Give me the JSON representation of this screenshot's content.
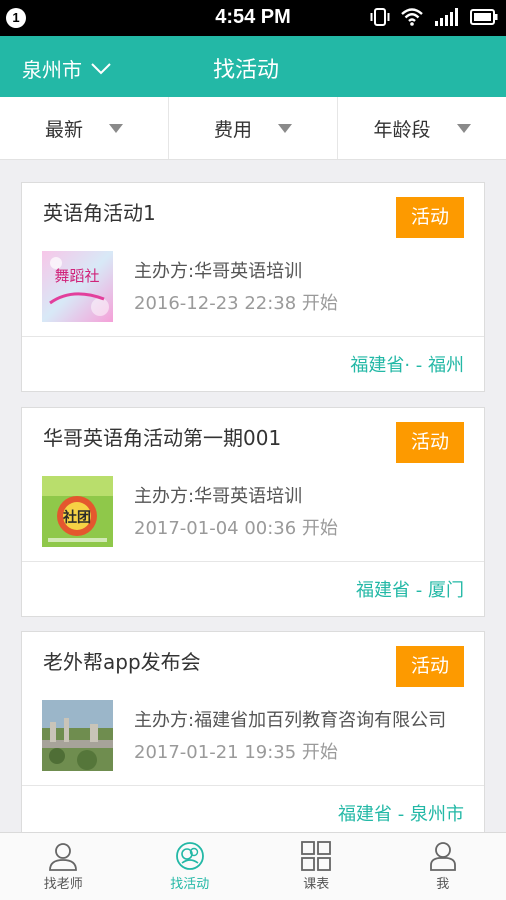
{
  "status_bar": {
    "notification_count": "1",
    "time": "4:54 PM"
  },
  "header": {
    "city": "泉州市",
    "title": "找活动"
  },
  "filters": [
    {
      "label": "最新"
    },
    {
      "label": "费用"
    },
    {
      "label": "年龄段"
    }
  ],
  "badge_label": "活动",
  "activities": [
    {
      "title": "英语角活动1",
      "organizer": "主办方:华哥英语培训",
      "datetime": "2016-12-23 22:38 开始",
      "location": "福建省· - 福州",
      "thumb_text": "舞蹈社"
    },
    {
      "title": "华哥英语角活动第一期001",
      "organizer": "主办方:华哥英语培训",
      "datetime": "2017-01-04 00:36 开始",
      "location": "福建省 - 厦门",
      "thumb_text": "社团"
    },
    {
      "title": "老外帮app发布会",
      "organizer": " 主办方:福建省加百列教育咨询有限公司",
      "datetime": "2017-01-21 19:35 开始",
      "location": "福建省 - 泉州市",
      "thumb_text": ""
    }
  ],
  "tabs": [
    {
      "label": "找老师",
      "icon": "teacher-icon"
    },
    {
      "label": "找活动",
      "icon": "activity-icon"
    },
    {
      "label": "课表",
      "icon": "schedule-icon"
    },
    {
      "label": "我",
      "icon": "profile-icon"
    }
  ],
  "colors": {
    "primary": "#23b8a6",
    "badge": "#fd9a00"
  }
}
